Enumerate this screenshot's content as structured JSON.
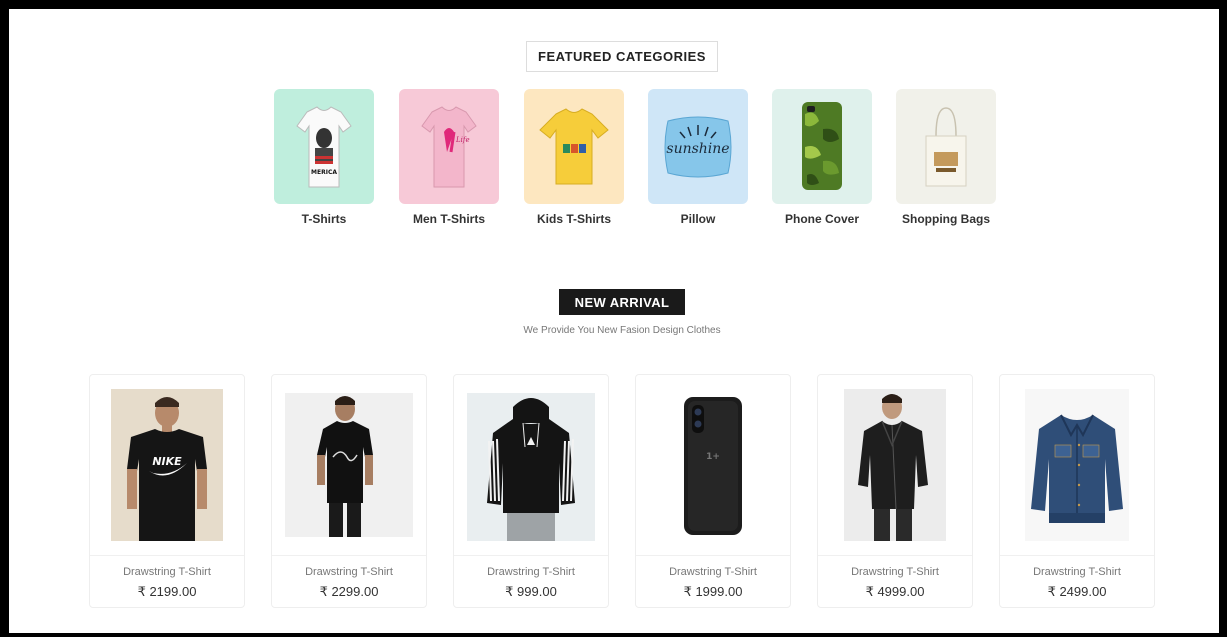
{
  "featured": {
    "title": "FEATURED CATEGORIES",
    "categories": [
      {
        "label": "T-Shirts",
        "bg": "#bfeedd",
        "icon": "tshirt-white-icon"
      },
      {
        "label": "Men T-Shirts",
        "bg": "#f7c9d7",
        "icon": "tshirt-pink-icon"
      },
      {
        "label": "Kids T-Shirts",
        "bg": "#fde7c0",
        "icon": "tshirt-yellow-icon"
      },
      {
        "label": "Pillow",
        "bg": "#cfe6f7",
        "icon": "pillow-icon"
      },
      {
        "label": "Phone Cover",
        "bg": "#dff1ec",
        "icon": "phone-cover-icon"
      },
      {
        "label": "Shopping Bags",
        "bg": "#f1f1ea",
        "icon": "shopping-bag-icon"
      }
    ]
  },
  "new_arrival": {
    "title": "NEW ARRIVAL",
    "subtitle": "We Provide You New Fasion Design Clothes"
  },
  "products": [
    {
      "name": "Drawstring T-Shirt",
      "price": "₹ 2199.00",
      "image": "nike-tshirt-image"
    },
    {
      "name": "Drawstring T-Shirt",
      "price": "₹ 2299.00",
      "image": "black-tshirt-image"
    },
    {
      "name": "Drawstring T-Shirt",
      "price": "₹ 999.00",
      "image": "adidas-hoodie-image"
    },
    {
      "name": "Drawstring T-Shirt",
      "price": "₹ 1999.00",
      "image": "phone-case-image"
    },
    {
      "name": "Drawstring T-Shirt",
      "price": "₹ 4999.00",
      "image": "leather-jacket-image"
    },
    {
      "name": "Drawstring T-Shirt",
      "price": "₹ 2499.00",
      "image": "denim-jacket-image"
    }
  ]
}
